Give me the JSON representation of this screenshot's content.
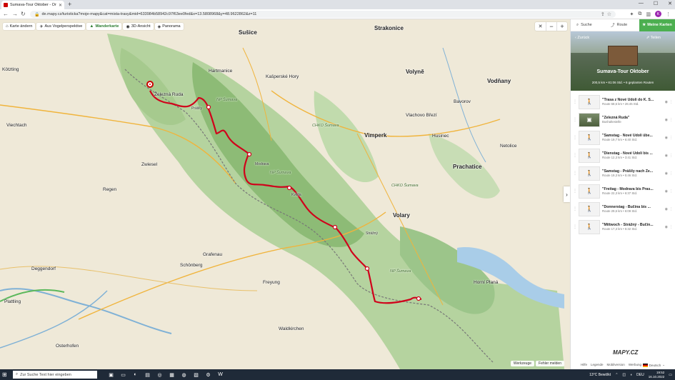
{
  "browser": {
    "tab_title": "Sumava-Tour Oktober - Ortl und",
    "url": "de.mapy.cz/turisticka?moje-mapy&cat=mista-trasy&mid=633984b58942c97f63ee0fed&x=13.5808968&y=48.9622862&z=11",
    "profile_initial": "K"
  },
  "map": {
    "modes": [
      {
        "icon": "⌂",
        "label": "Karte ändern",
        "active": false
      },
      {
        "icon": "✈",
        "label": "Aus Vogelperspektive",
        "active": false
      },
      {
        "icon": "▲",
        "label": "Wanderkarte",
        "active": true
      },
      {
        "icon": "◉",
        "label": "3D-Ansicht",
        "active": false
      },
      {
        "icon": "◈",
        "label": "Panorama",
        "active": false
      }
    ],
    "zoom_in": "+",
    "zoom_out": "−",
    "collapse": "›",
    "bottom_links": [
      "Werkzeuge",
      "Fehler melden"
    ],
    "labels": [
      {
        "text": "Sušice",
        "cls": "big"
      },
      {
        "text": "Strakonice",
        "cls": "big"
      },
      {
        "text": "Volyně",
        "cls": "big"
      },
      {
        "text": "Vodňany",
        "cls": "big"
      },
      {
        "text": "Kötzting",
        "cls": ""
      },
      {
        "text": "Hartmanice",
        "cls": ""
      },
      {
        "text": "Kašperské Hory",
        "cls": ""
      },
      {
        "text": "Železná Ruda",
        "cls": ""
      },
      {
        "text": "Vimperk",
        "cls": "big"
      },
      {
        "text": "Prachatice",
        "cls": "big"
      },
      {
        "text": "Viechtach",
        "cls": ""
      },
      {
        "text": "Zwiesel",
        "cls": ""
      },
      {
        "text": "Regen",
        "cls": ""
      },
      {
        "text": "Volary",
        "cls": "big"
      },
      {
        "text": "Grafenau",
        "cls": ""
      },
      {
        "text": "Schönberg",
        "cls": ""
      },
      {
        "text": "Freyung",
        "cls": ""
      },
      {
        "text": "Deggendorf",
        "cls": ""
      },
      {
        "text": "Plattling",
        "cls": ""
      },
      {
        "text": "Waldkirchen",
        "cls": ""
      },
      {
        "text": "Osterhofen",
        "cls": ""
      },
      {
        "text": "Horní Planá",
        "cls": ""
      },
      {
        "text": "Bavorov",
        "cls": ""
      },
      {
        "text": "Netolice",
        "cls": ""
      },
      {
        "text": "Husinec",
        "cls": ""
      },
      {
        "text": "Vlachovo Březí",
        "cls": ""
      },
      {
        "text": "Kvilda",
        "cls": "small"
      },
      {
        "text": "Modrava",
        "cls": "small"
      },
      {
        "text": "Prášily",
        "cls": "small"
      },
      {
        "text": "Strážný",
        "cls": "small"
      },
      {
        "text": "NP Šumava",
        "cls": "np"
      },
      {
        "text": "NP Šumava",
        "cls": "np"
      },
      {
        "text": "CHKO Šumava",
        "cls": "np"
      },
      {
        "text": "CHKO Šumava",
        "cls": "np"
      },
      {
        "text": "NP Šumava",
        "cls": "np"
      }
    ]
  },
  "panel": {
    "search_label": "Suche",
    "route_label": "Route",
    "my_map_label": "Meine Karten",
    "back_label": "Zurück",
    "share_label": "Teilen",
    "title": "Sumava-Tour Oktober",
    "meta": "200,5 km • 81:06 Std. • 6 geplanten Routen",
    "routes": [
      {
        "icon": "🚶",
        "title": "\"Trasa z Nové Údolí do K. S...",
        "sub": "Route 68,6 km • 26:45 Std.",
        "photo": false
      },
      {
        "icon": "▣",
        "title": "\"Železná Ruda\"",
        "sub": "Bushaltestelle",
        "photo": true
      },
      {
        "icon": "🚶",
        "title": "\"Samstag - Nové Údolí übe...",
        "sub": "Route 19,7 km • 6:40 Std.",
        "photo": false
      },
      {
        "icon": "🚶",
        "title": "\"Dienstag - Nové Údolí bis ...",
        "sub": "Route 12,3 km • 3:41 Std.",
        "photo": false
      },
      {
        "icon": "🚶",
        "title": "\"Samstag - Prášily nach Že...",
        "sub": "Route 19,3 km • 5:46 Std.",
        "photo": false
      },
      {
        "icon": "🚶",
        "title": "\"Freitag - Modrava bis Pras...",
        "sub": "Route 22,3 km • 6:37 Std.",
        "photo": false
      },
      {
        "icon": "🚶",
        "title": "\"Donnerstag - Bučina bis ...",
        "sub": "Route 29,6 km • 6:09 Std.",
        "photo": false
      },
      {
        "icon": "🚶",
        "title": "\"Mittwoch - Strážný - Bučin...",
        "sub": "Route 17,3 km • 5:32 Std.",
        "photo": false
      }
    ],
    "logo": "MAPY.CZ",
    "footer_links": [
      "Hilfe",
      "Legende",
      "Mobilversion",
      "Werbung"
    ],
    "language": "Deutsch"
  },
  "taskbar": {
    "search_placeholder": "Zur Suche Text hier eingeben",
    "weather": "13°C  Bewölkt",
    "tray_lang": "DEU",
    "time": "19:52",
    "date": "16.10.2022"
  },
  "colors": {
    "route": "#d0021b",
    "accent": "#4caf50",
    "forest": "#9cc58a"
  }
}
